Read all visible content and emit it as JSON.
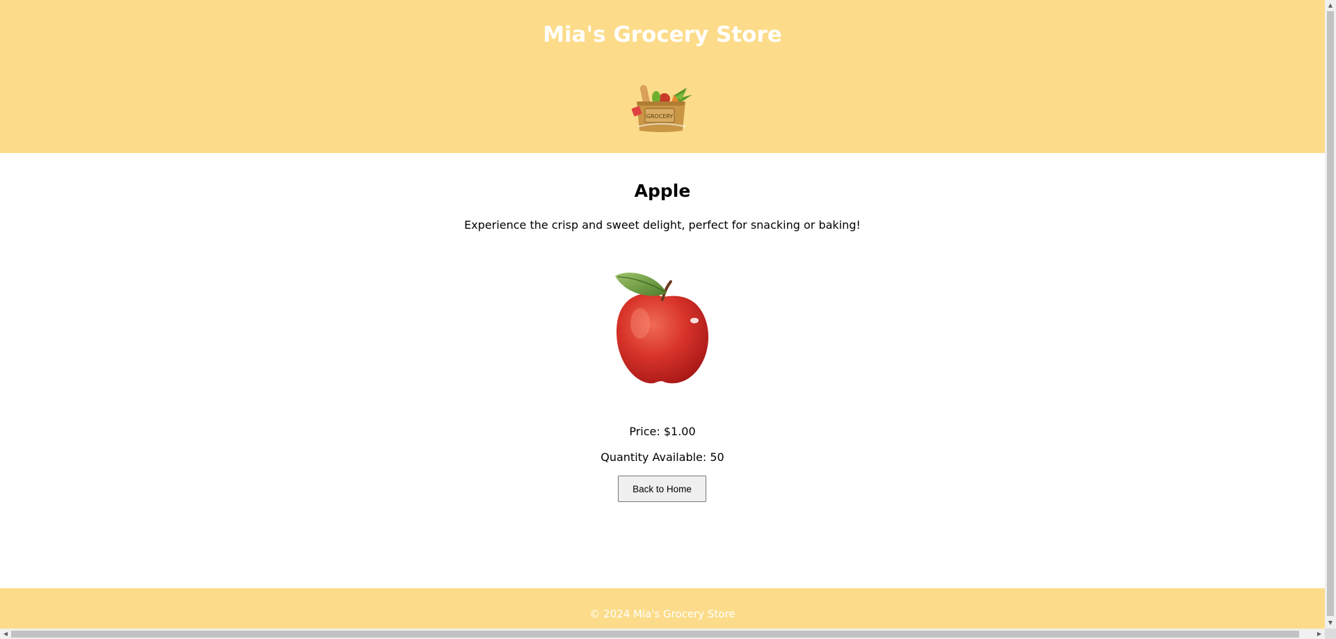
{
  "header": {
    "title": "Mia's Grocery Store",
    "logo_icon": "grocery-bag-icon",
    "logo_text": "GROCERY"
  },
  "product": {
    "name": "Apple",
    "description": "Experience the crisp and sweet delight, perfect for snacking or baking!",
    "image_icon": "apple-icon",
    "price_text": "Price: $1.00",
    "quantity_text": "Quantity Available: 50"
  },
  "actions": {
    "back_label": "Back to Home"
  },
  "footer": {
    "copyright": "© 2024 Mia's Grocery Store"
  },
  "colors": {
    "header_bg": "#fcdc8a",
    "footer_bg": "#fcdc8a",
    "title_text": "#ffffff",
    "page_bg": "#ffffff"
  }
}
